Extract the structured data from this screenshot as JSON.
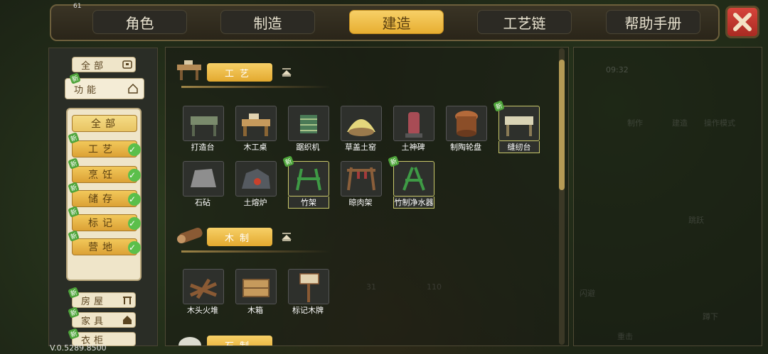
{
  "fps": "61",
  "top_tabs": [
    "角色",
    "制造",
    "建造",
    "工艺链",
    "帮助手册"
  ],
  "active_tab": "建造",
  "left_nav": {
    "all_label": "全部",
    "function_label": "功能",
    "sub_all_label": "全部",
    "sub_categories": [
      "工艺",
      "烹饪",
      "储存",
      "标记",
      "营地"
    ],
    "more_categories": [
      "房屋",
      "家具",
      "衣柜"
    ]
  },
  "new_tag": "新",
  "version": "V.0.5289.8500",
  "sections": [
    {
      "title": "工艺",
      "items": [
        "打造台",
        "木工桌",
        "踞织机",
        "草盖土窑",
        "土神碑",
        "制陶轮盘",
        "缝纫台",
        "石砧",
        "土熔炉",
        "竹架",
        "晾肉架",
        "竹制净水器"
      ]
    },
    {
      "title": "木制",
      "items": [
        "木头火堆",
        "木箱",
        "标记木牌"
      ]
    },
    {
      "title": "石制",
      "items": []
    }
  ],
  "background_hud": {
    "clock": "09:32",
    "labels": [
      "制作",
      "建造",
      "操作模式",
      "跳跃",
      "闪避",
      "蹲下",
      "重击"
    ],
    "counts": [
      "31",
      "110"
    ]
  },
  "colors": {
    "accent_gold": "#f2c85a",
    "panel_bg": "#2a2d26",
    "close_red": "#c63a30",
    "check_green": "#5bbf4b",
    "new_green": "#4ea43a"
  }
}
